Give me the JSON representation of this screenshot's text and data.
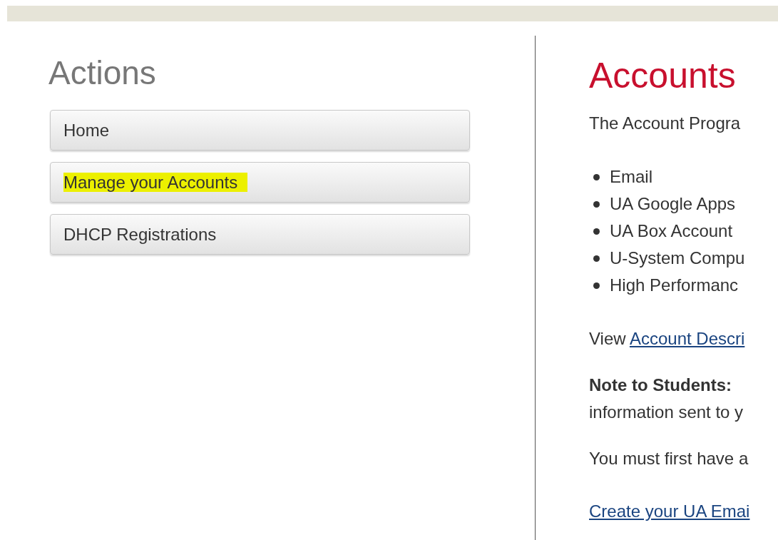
{
  "sidebar": {
    "title": "Actions",
    "items": [
      {
        "label": "Home",
        "highlighted": false
      },
      {
        "label": "Manage your Accounts",
        "highlighted": true
      },
      {
        "label": "DHCP Registrations",
        "highlighted": false
      }
    ]
  },
  "content": {
    "title": "Accounts",
    "intro": "The Account Progra",
    "list": [
      "Email",
      "UA Google Apps",
      "UA Box Account",
      "U-System Compu",
      "High Performanc"
    ],
    "view_prefix": "View",
    "view_link": "Account Descri",
    "note_lines": [
      "**Note to Students:**",
      "information sent to y"
    ],
    "must": "You must first have a",
    "create_link": "Create your UA Emai"
  }
}
